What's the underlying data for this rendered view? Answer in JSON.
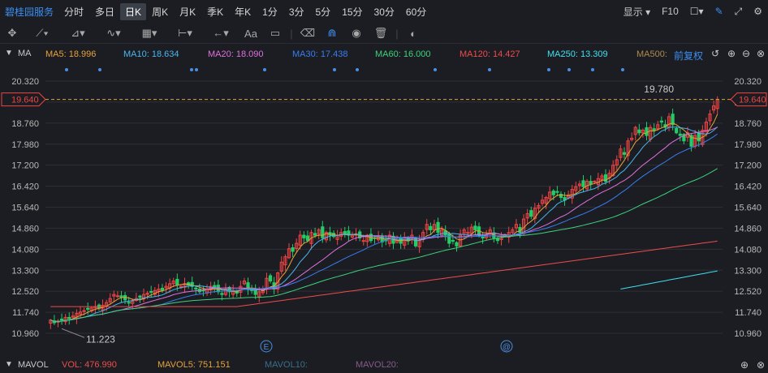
{
  "toolbar": {
    "stock_name": "碧桂园服务",
    "periods": [
      "分时",
      "多日",
      "日K",
      "周K",
      "月K",
      "季K",
      "年K",
      "1分",
      "3分",
      "5分",
      "15分",
      "30分",
      "60分"
    ],
    "active_period": "日K",
    "display_label": "显示",
    "f10_label": "F10"
  },
  "ma_bar": {
    "label": "MA",
    "items": [
      {
        "text": "MA5: 18.996",
        "color": "#e8a23a"
      },
      {
        "text": "MA10: 18.634",
        "color": "#4ab6f0"
      },
      {
        "text": "MA20: 18.090",
        "color": "#e070e0"
      },
      {
        "text": "MA30: 17.438",
        "color": "#3a7cf0"
      },
      {
        "text": "MA60: 16.000",
        "color": "#3ed27a"
      },
      {
        "text": "MA120: 14.427",
        "color": "#ee4c4c"
      },
      {
        "text": "MA250: 13.309",
        "color": "#40e0f0"
      },
      {
        "text": "MA500:",
        "color": "#b08a50"
      }
    ],
    "adjust_label": "前复权"
  },
  "vol_bar": {
    "label": "MAVOL",
    "items": [
      {
        "text": "VOL: 476.990",
        "color": "#ee4c4c"
      },
      {
        "text": "MAVOL5: 751.151",
        "color": "#e8a23a"
      },
      {
        "text": "MAVOL10:",
        "color": "#3a6e8c"
      },
      {
        "text": "MAVOL20:",
        "color": "#8a5a8a"
      }
    ]
  },
  "colors": {
    "up": "#ee4444",
    "down": "#22cc66",
    "bg": "#1b1d22",
    "grid": "#2c3036",
    "price_line": "#d9a441"
  },
  "chart_data": {
    "type": "candlestick",
    "ylim": [
      10.96,
      20.32
    ],
    "y_ticks": [
      "20.320",
      "19.540",
      "18.760",
      "17.980",
      "17.200",
      "16.420",
      "15.640",
      "14.860",
      "14.080",
      "13.300",
      "12.520",
      "11.740",
      "10.960"
    ],
    "current_price": "19.640",
    "annotations": {
      "high": "19.780",
      "low": "11.223"
    },
    "event_markers": [
      "E",
      "@"
    ],
    "close": [
      11.45,
      11.35,
      11.4,
      11.45,
      11.55,
      11.5,
      11.6,
      11.7,
      11.75,
      11.8,
      11.85,
      11.9,
      11.95,
      11.9,
      12.0,
      12.1,
      12.25,
      12.4,
      12.35,
      12.3,
      12.2,
      12.1,
      12.15,
      12.25,
      12.3,
      12.4,
      12.45,
      12.5,
      12.55,
      12.6,
      12.55,
      12.7,
      12.8,
      12.9,
      12.75,
      12.7,
      12.8,
      12.75,
      12.7,
      12.6,
      12.5,
      12.55,
      12.6,
      12.7,
      12.65,
      12.5,
      12.4,
      12.6,
      12.5,
      12.55,
      12.45,
      12.7,
      12.9,
      12.6,
      12.55,
      12.4,
      12.5,
      12.6,
      13.0,
      12.9,
      12.6,
      13.2,
      13.6,
      13.8,
      14.1,
      14.0,
      14.3,
      14.6,
      14.5,
      14.4,
      14.7,
      14.6,
      14.8,
      14.5,
      14.7,
      14.6,
      14.55,
      14.6,
      14.7,
      14.65,
      14.6,
      14.6,
      14.65,
      14.5,
      14.4,
      14.6,
      14.4,
      14.5,
      14.55,
      14.35,
      14.4,
      14.6,
      14.3,
      14.4,
      14.3,
      14.5,
      14.4,
      14.6,
      14.2,
      14.4,
      14.7,
      15.0,
      14.8,
      15.0,
      14.7,
      14.8,
      14.6,
      14.3,
      14.4,
      14.2,
      14.6,
      14.8,
      14.7,
      14.9,
      14.8,
      14.6,
      14.5,
      14.6,
      14.8,
      14.5,
      14.4,
      14.5,
      14.6,
      14.7,
      14.8,
      15.0,
      14.7,
      15.2,
      15.4,
      15.3,
      15.6,
      15.7,
      15.9,
      16.0,
      16.2,
      16.1,
      16.2,
      16.0,
      15.9,
      16.1,
      16.3,
      16.4,
      16.5,
      16.4,
      16.6,
      16.5,
      16.6,
      16.7,
      16.8,
      16.6,
      16.9,
      17.2,
      17.4,
      17.8,
      17.6,
      18.1,
      18.2,
      18.6,
      18.4,
      18.5,
      18.3,
      18.6,
      18.5,
      18.7,
      18.8,
      18.6,
      19.0,
      18.7,
      18.4,
      18.3,
      18.1,
      18.4,
      17.9,
      18.3,
      18.1,
      18.5,
      18.8,
      19.1,
      19.4,
      19.64
    ]
  }
}
